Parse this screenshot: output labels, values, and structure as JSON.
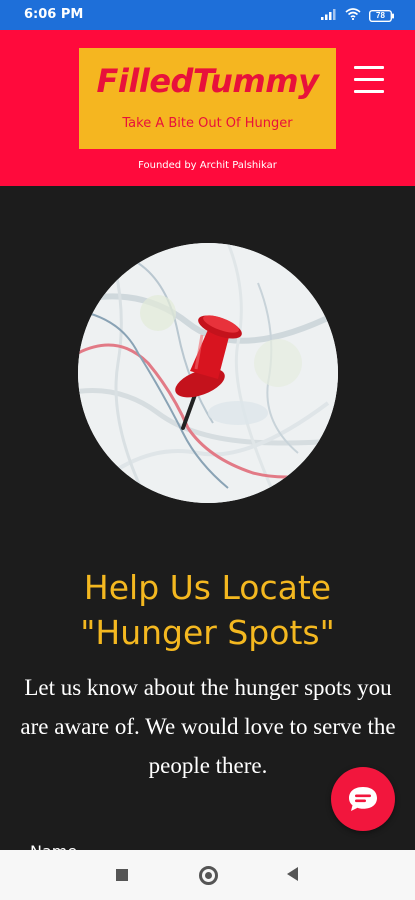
{
  "status_bar": {
    "time": "6:06 PM",
    "battery": "78",
    "icons": [
      "signal-icon",
      "wifi-icon",
      "battery-icon"
    ]
  },
  "header": {
    "brand": "FilledTummy",
    "tagline": "Take A Bite Out Of Hunger",
    "founder": "Founded by Archit Palshikar",
    "menu_icon": "hamburger-menu-icon",
    "colors": {
      "header_bg": "#ff0a3c",
      "logo_bg": "#f5b620",
      "logo_text": "#e8113b"
    }
  },
  "hero": {
    "image": "map-pushpin-image"
  },
  "main": {
    "headline_line1": "Help Us Locate",
    "headline_line2": "\"Hunger Spots\"",
    "body": "Let us know about the hunger spots you are aware of. We would love to serve the people there.",
    "form_first_label": "Name",
    "colors": {
      "headline": "#f4b820",
      "background": "#1c1c1c"
    }
  },
  "chat": {
    "icon": "chat-bubble-icon",
    "color": "#f2163d"
  },
  "nav_bar": {
    "buttons": [
      "recents-square-icon",
      "home-circle-icon",
      "back-triangle-icon"
    ]
  }
}
